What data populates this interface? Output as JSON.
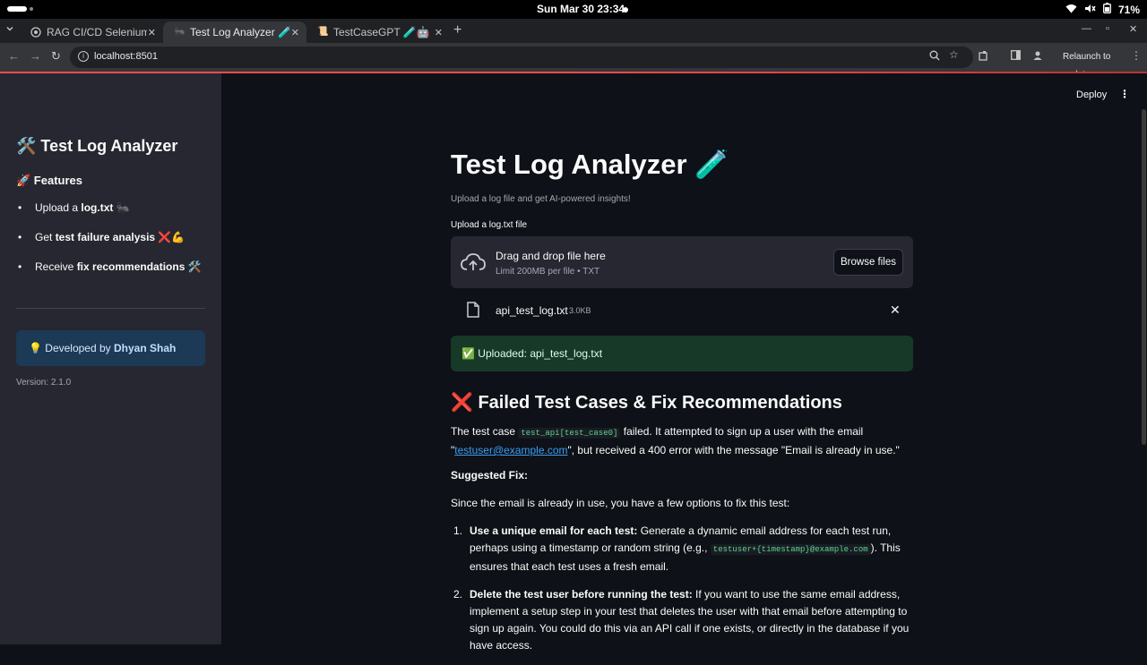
{
  "os": {
    "clock": "Sun Mar 30  23:34",
    "battery": "71%"
  },
  "tabs": [
    {
      "title": "RAG CI/CD Selenium Te",
      "favicon": "globe-icon"
    },
    {
      "title": "Test Log Analyzer 🧪",
      "favicon": "ant-icon"
    },
    {
      "title": "TestCaseGPT 🧪🤖",
      "favicon": "scroll-icon"
    }
  ],
  "address": {
    "url": "localhost:8501",
    "relaunch": "Relaunch to update"
  },
  "sidebar": {
    "title": "🛠️ Test Log Analyzer",
    "features_heading": "🚀 Features",
    "items": [
      {
        "prefix": "Upload a ",
        "bold": "log.txt",
        "suffix": " 🐜"
      },
      {
        "prefix": "Get ",
        "bold": "test failure analysis",
        "suffix": " ❌💪"
      },
      {
        "prefix": "Receive ",
        "bold": "fix recommendations",
        "suffix": " 🛠️"
      }
    ],
    "dev_prefix": "💡 Developed by ",
    "dev_name": "Dhyan Shah",
    "version": "Version: 2.1.0"
  },
  "header": {
    "deploy": "Deploy",
    "menu": "⋮"
  },
  "main": {
    "title": "Test Log Analyzer 🧪",
    "caption": "Upload a log file and get AI-powered insights!",
    "upload_label": "Upload a log.txt file",
    "drop_title": "Drag and drop file here",
    "drop_sub": "Limit 200MB per file • TXT",
    "browse": "Browse files",
    "file_name": "api_test_log.txt",
    "file_size": "3.0KB",
    "success": "✅ Uploaded: api_test_log.txt",
    "section_title": "❌ Failed Test Cases & Fix Recommendations",
    "p1_a": "The test case ",
    "p1_code": "test_api[test_case0]",
    "p1_b": " failed. It attempted to sign up a user with the email",
    "p1_c": "\"",
    "p1_link": "testuser@example.com",
    "p1_d": "\", but received a 400 error with the message \"Email is already in use.\"",
    "fix_heading": "Suggested Fix:",
    "fix_intro": "Since the email is already in use, you have a few options to fix this test:",
    "fixes": [
      {
        "num": "1.",
        "bold": "Use a unique email for each test:",
        "text_a": " Generate a dynamic email address for each test run, perhaps using a timestamp or random string (e.g., ",
        "code": "testuser+{timestamp}@example.com",
        "text_b": "). This ensures that each test uses a fresh email."
      },
      {
        "num": "2.",
        "bold": "Delete the test user before running the test:",
        "text_a": " If you want to use the same email address, implement a setup step in your test that deletes the user with that email before attempting to sign up again. You could do this via an API call if one exists, or directly in the database if you have access.",
        "code": "",
        "text_b": ""
      }
    ]
  },
  "colors": {
    "accent": "#ff4b4b",
    "sidebar_bg": "#262730",
    "main_bg": "#0e1117",
    "success_bg": "#173928",
    "info_bg": "#1c3956",
    "link": "#3d9df3"
  }
}
